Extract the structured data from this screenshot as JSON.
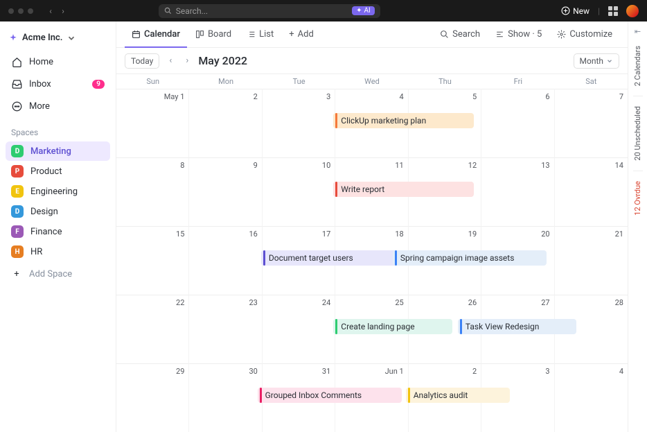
{
  "topbar": {
    "search_placeholder": "Search...",
    "ai_label": "AI",
    "new_label": "New"
  },
  "workspace": {
    "name": "Acme Inc."
  },
  "nav": {
    "home": "Home",
    "inbox": "Inbox",
    "inbox_badge": "9",
    "more": "More"
  },
  "spaces": {
    "label": "Spaces",
    "add_label": "Add Space",
    "items": [
      {
        "letter": "D",
        "name": "Marketing",
        "color": "#2ecc71",
        "active": true
      },
      {
        "letter": "P",
        "name": "Product",
        "color": "#e74c3c"
      },
      {
        "letter": "E",
        "name": "Engineering",
        "color": "#f1c40f"
      },
      {
        "letter": "D",
        "name": "Design",
        "color": "#3498db"
      },
      {
        "letter": "F",
        "name": "Finance",
        "color": "#9b59b6"
      },
      {
        "letter": "H",
        "name": "HR",
        "color": "#e67e22"
      }
    ]
  },
  "toolbar": {
    "calendar": "Calendar",
    "board": "Board",
    "list": "List",
    "add": "Add",
    "search": "Search",
    "show": "Show · 5",
    "customize": "Customize"
  },
  "subbar": {
    "today": "Today",
    "title": "May 2022",
    "view": "Month"
  },
  "dow": [
    "Sun",
    "Mon",
    "Tue",
    "Wed",
    "Thu",
    "Fri",
    "Sat"
  ],
  "days": [
    "May 1",
    "2",
    "3",
    "4",
    "5",
    "6",
    "7",
    "8",
    "9",
    "10",
    "11",
    "12",
    "13",
    "14",
    "15",
    "16",
    "17",
    "18",
    "19",
    "20",
    "21",
    "22",
    "23",
    "24",
    "25",
    "26",
    "27",
    "28",
    "29",
    "30",
    "31",
    "Jun 1",
    "2",
    "3",
    "4"
  ],
  "events": [
    {
      "title": "ClickUp marketing plan",
      "row": 0,
      "colStart": 3,
      "colSpan": 2,
      "bg": "#fde9cc",
      "bar": "#f5793a"
    },
    {
      "title": "Write report",
      "row": 1,
      "colStart": 3,
      "colSpan": 2,
      "bg": "#fde2e2",
      "bar": "#e74c3c"
    },
    {
      "title": "Document target users",
      "row": 2,
      "colStart": 2,
      "colSpan": 2,
      "bg": "#e7e6fb",
      "bar": "#5d4fd1"
    },
    {
      "title": "Spring campaign image assets",
      "row": 2,
      "colStart": 3.82,
      "colSpan": 2.18,
      "bg": "#e4eef9",
      "bar": "#3b82f6"
    },
    {
      "title": "Create landing page",
      "row": 3,
      "colStart": 3,
      "colSpan": 1.7,
      "bg": "#dff5ee",
      "bar": "#2ecc71"
    },
    {
      "title": "Task View Redesign",
      "row": 3,
      "colStart": 4.72,
      "colSpan": 1.7,
      "bg": "#e4eef9",
      "bar": "#3b82f6"
    },
    {
      "title": "Grouped Inbox Comments",
      "row": 4,
      "colStart": 1.95,
      "colSpan": 2.05,
      "bg": "#fde2ec",
      "bar": "#e91e63"
    },
    {
      "title": "Analytics audit",
      "row": 4,
      "colStart": 4,
      "colSpan": 1.5,
      "bg": "#fdf3dc",
      "bar": "#f1c40f"
    }
  ],
  "rail": {
    "calendars": "2 Calendars",
    "unscheduled": "20 Unscheduled",
    "overdue": "12 Ovrdue"
  }
}
